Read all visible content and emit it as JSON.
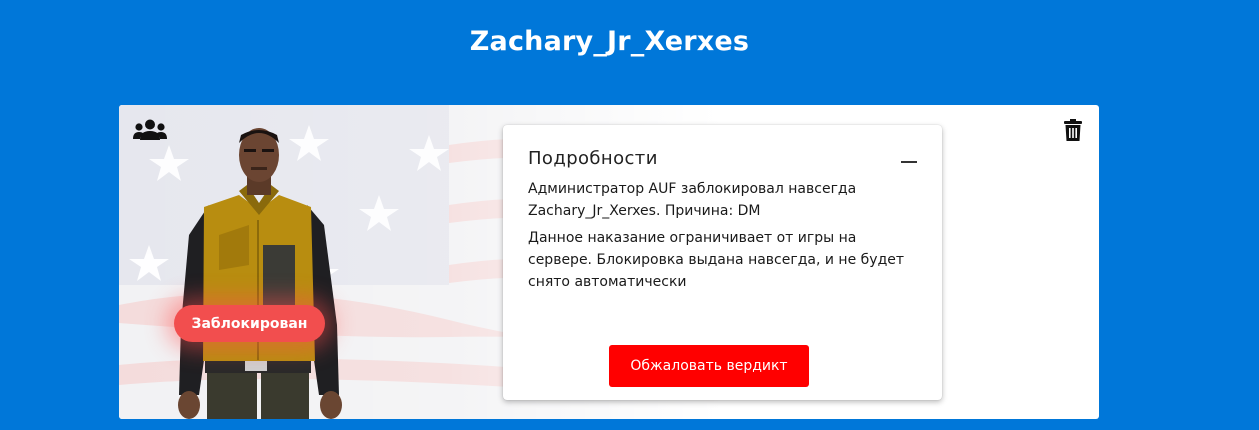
{
  "header": {
    "player_name": "Zachary_Jr_Xerxes"
  },
  "card": {
    "status_badge": "Заблокирован",
    "icons": {
      "top_left": "users-icon",
      "top_right": "trash-icon",
      "collapse": "minus-icon"
    }
  },
  "details": {
    "title": "Подробности",
    "summary": "Администратор AUF заблокировал навсегда Zachary_Jr_Xerxes. Причина: DM",
    "description": "Данное наказание ограничивает от игры на сервере. Блокировка выдана навсегда, и не будет снято автоматически",
    "appeal_button": "Обжаловать вердикт"
  },
  "colors": {
    "page_background": "#0077d9",
    "badge": "#f24e4e",
    "appeal_button": "#ff0000",
    "text": "#1a1a1a"
  }
}
